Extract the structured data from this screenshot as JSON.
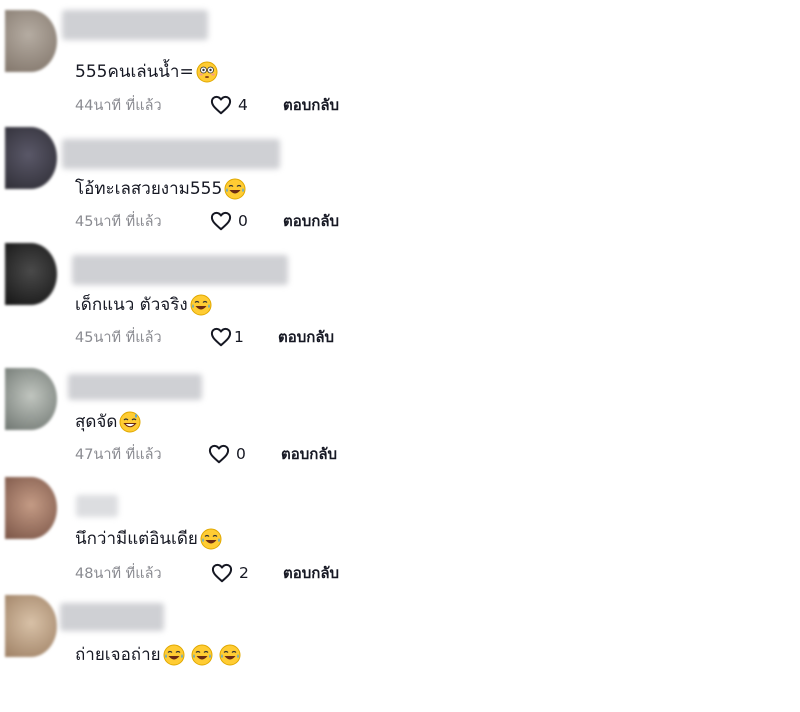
{
  "comments": [
    {
      "text": "555คนเล่นน้ำ=",
      "time": "44นาที ที่แล้ว",
      "likes": "4",
      "reply": "ตอบกลับ",
      "emojis": [
        "flushed-face"
      ],
      "avatar_color": "#8e8176"
    },
    {
      "text": "โอ้ทะเลสวยงาม555",
      "time": "45นาที ที่แล้ว",
      "likes": "0",
      "reply": "ตอบกลับ",
      "emojis": [
        "tears-of-joy"
      ],
      "avatar_color": "#3b3a45"
    },
    {
      "text": "เด็กแนว ตัวจริง",
      "time": "45นาที ที่แล้ว",
      "likes": "1",
      "reply": "ตอบกลับ",
      "emojis": [
        "tears-of-joy"
      ],
      "avatar_color": "#2a2a2a"
    },
    {
      "text": "สุดจัด",
      "time": "47นาที ที่แล้ว",
      "likes": "0",
      "reply": "ตอบกลับ",
      "emojis": [
        "grinning-sweat"
      ],
      "avatar_color": "#8f9690"
    },
    {
      "text": "นึกว่ามีแต่อินเดีย",
      "time": "48นาที ที่แล้ว",
      "likes": "2",
      "reply": "ตอบกลับ",
      "emojis": [
        "tears-of-joy"
      ],
      "avatar_color": "#9d7462"
    },
    {
      "text": "ถ่ายเจอถ่าย ",
      "emojis": [
        "tears-of-joy",
        "tears-of-joy",
        "tears-of-joy"
      ],
      "avatar_color": "#c4a78e"
    }
  ],
  "colors": {
    "text": "#161823",
    "meta": "#8a8b91",
    "emoji_face": "#ffcc33",
    "tears": "#4aa3df"
  }
}
